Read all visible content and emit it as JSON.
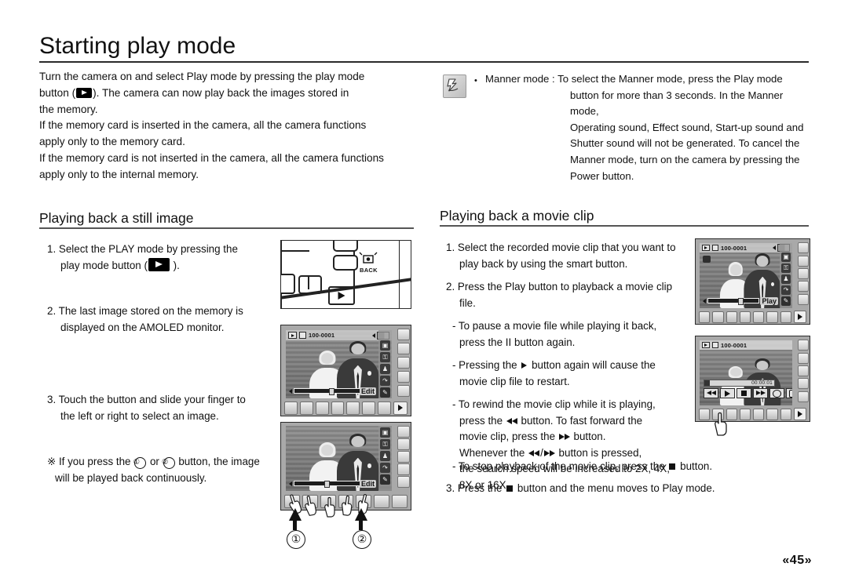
{
  "document": {
    "title": "Starting play mode",
    "page_number": "«45»"
  },
  "intro": {
    "line1_a": "Turn the camera on and",
    "line1_b": "select Play mode by pressing the play mode",
    "line2_a": "button (",
    "line2_b": "). The camera can now   play back the images stored in",
    "line3": "the memory.",
    "line4": "If the memory card is inserted in the camera, all the camera functions",
    "line5": "apply only to the memory card.",
    "line6": "If the memory card is not inserted in the camera, all the camera functions",
    "line7": "apply only to the internal memory."
  },
  "note": {
    "icon": "note-hand-icon",
    "bullet": "•",
    "lead": "Manner mode : To select the Manner mode, press the Play mode",
    "lines": [
      "button for more than 3 seconds. In the Manner mode,",
      "Operating sound, Effect sound, Start-up sound and",
      "Shutter sound will not be generated. To cancel the",
      "Manner mode, turn on the camera by pressing the",
      "Power button."
    ]
  },
  "left_section": {
    "heading": "Playing back a still image",
    "step1_a": "1. Select the PLAY mode by pressing the",
    "step1_b": "play mode button (",
    "step1_c": ").",
    "step2_a": "2. The last image stored on the memory is",
    "step2_b": "displayed on the AMOLED monitor.",
    "step3_a": "3. Touch the button and slide your finger to",
    "step3_b": "the left or right to select an image.",
    "note_mark": "※",
    "note_a": " If you press the ",
    "note_b": " or ",
    "note_c": " button, the image",
    "note_d": "will be played back continuously.",
    "callout_1": "①",
    "callout_2": "②"
  },
  "right_section": {
    "heading": "Playing back a movie clip",
    "step1_a": "1. Select the recorded movie clip that you want to",
    "step1_b": "play back by using the smart button.",
    "step2_a": "2. Press the Play button to playback a movie clip",
    "step2_b": "file.",
    "sub1_a": "- To pause a movie file while playing it back,",
    "sub1_b": "press the II button again.",
    "sub2_a": "- Pressing the ",
    "sub2_b": " button again will cause the",
    "sub2_c": "movie clip file to restart.",
    "sub3_a": "- To rewind the movie clip while it is playing,",
    "sub3_b": "press the ",
    "sub3_c": " button. To fast forward the",
    "sub3_d": "movie clip, press the ",
    "sub3_e": " button.",
    "sub3_f": "Whenever the ",
    "sub3_g": "/",
    "sub3_h": " button is pressed,",
    "sub3_i": "the search speed will be increased to 2X, 4X,",
    "sub3_j": "8X or 16X.",
    "sub4_a": "- To stop playback of the movie clip, press the ",
    "sub4_b": " button.",
    "step3_a": "3. Press the ",
    "step3_b": " button and the menu moves to Play mode."
  },
  "illustrations": {
    "camera_back": {
      "name": "camera-back-diagram",
      "back_label": "BACK",
      "play_button": "play-button"
    },
    "lcd_still": {
      "name": "lcd-still-image",
      "file_label": "100-0001",
      "edit_label": "Edit",
      "side_icons": [
        "movie-icon",
        "lock-icon",
        "person-icon",
        "rotate-icon",
        "pencil-icon"
      ]
    },
    "lcd_slide": {
      "name": "lcd-slide-finger",
      "edit_label": "Edit",
      "side_icons": [
        "movie-icon",
        "lock-icon",
        "person-icon",
        "rotate-icon",
        "pencil-icon"
      ]
    },
    "lcd_movie_select": {
      "name": "lcd-movie-select",
      "file_label": "100-0001",
      "play_label": "Play",
      "side_icons": [
        "movie-icon",
        "lock-icon",
        "person-icon",
        "rotate-icon",
        "pencil-icon"
      ]
    },
    "lcd_movie_playing": {
      "name": "lcd-movie-playing",
      "file_label": "100-0001",
      "timecode": "00:00:01",
      "transport": [
        "rewind-button",
        "play-button",
        "stop-button",
        "fast-forward-button",
        "volume-button",
        "capture-button"
      ]
    }
  },
  "colors": {
    "text": "#111111",
    "rule": "#2a2a2a",
    "section_rule": "#555555",
    "lcd_body": "#a9a9a9",
    "lcd_screen": "#8f8f8f"
  }
}
